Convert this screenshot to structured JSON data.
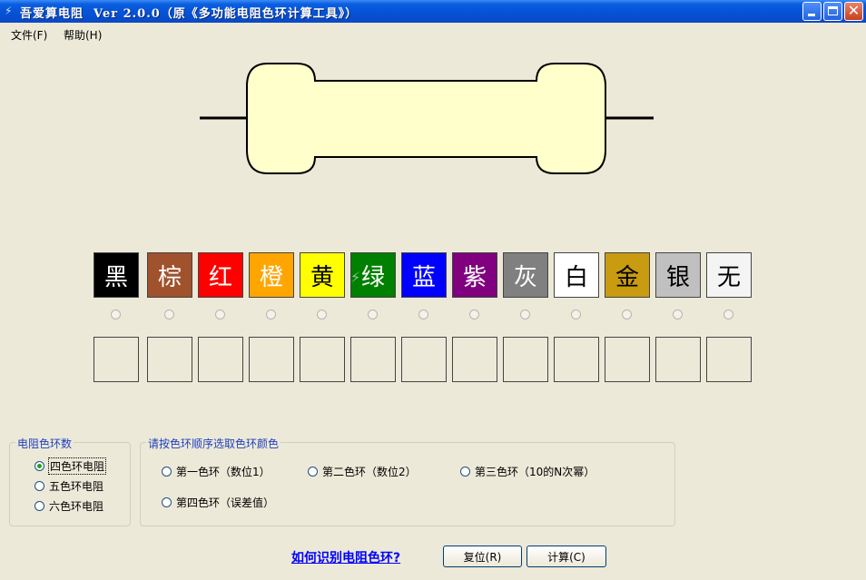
{
  "window": {
    "title": "吾爱算电阻  Ver 2.0.0（原《多功能电阻色环计算工具》）",
    "app_icon": "resistor-icon",
    "controls": [
      "minimize-icon",
      "maximize-icon",
      "close-icon"
    ]
  },
  "menu": [
    "文件(F)",
    "帮助(H)"
  ],
  "colors": [
    {
      "label": "黑",
      "bg": "#000000",
      "fg": "#ffffff"
    },
    {
      "label": "棕",
      "bg": "#a0522d",
      "fg": "#ffffff"
    },
    {
      "label": "红",
      "bg": "#ff0000",
      "fg": "#ffffff"
    },
    {
      "label": "橙",
      "bg": "#ffa500",
      "fg": "#ffffff"
    },
    {
      "label": "黄",
      "bg": "#ffff00",
      "fg": "#000000"
    },
    {
      "label": "绿",
      "bg": "#008000",
      "fg": "#ffffff"
    },
    {
      "label": "蓝",
      "bg": "#0000ff",
      "fg": "#ffffff"
    },
    {
      "label": "紫",
      "bg": "#800080",
      "fg": "#ffffff"
    },
    {
      "label": "灰",
      "bg": "#808080",
      "fg": "#ffffff"
    },
    {
      "label": "白",
      "bg": "#ffffff",
      "fg": "#000000"
    },
    {
      "label": "金",
      "bg": "#c89b10",
      "fg": "#000000"
    },
    {
      "label": "银",
      "bg": "#c0c0c0",
      "fg": "#000000"
    },
    {
      "label": "无",
      "bg": "#f4f4f4",
      "fg": "#000000"
    }
  ],
  "band_count_group": {
    "title": "电阻色环数",
    "options": [
      "四色环电阻",
      "五色环电阻",
      "六色环电阻"
    ],
    "selected": "四色环电阻"
  },
  "band_order_group": {
    "title": "请按色环顺序选取色环颜色",
    "options": [
      "第一色环（数位1）",
      "第二色环（数位2）",
      "第三色环（10的N次幂）",
      "第四色环（误差值）"
    ]
  },
  "help_link": "如何识别电阻色环?",
  "reset_button": "复位(R)",
  "calc_button": "计算(C)",
  "theme": {
    "resistor_body": "#ffffcc",
    "titlebar": "#0552d6",
    "group_title": "#1f3fbf"
  }
}
